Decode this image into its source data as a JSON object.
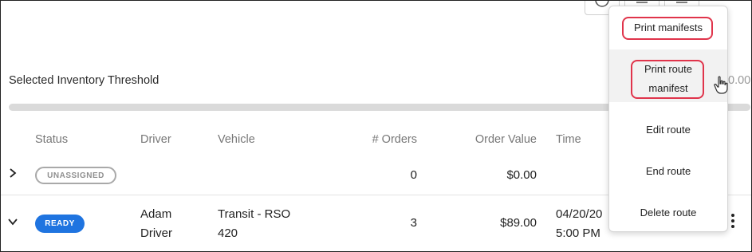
{
  "threshold": {
    "label": "Selected Inventory Threshold",
    "value_partial": "0.00",
    "progress_fraction": 0.0
  },
  "table": {
    "headers": [
      "Status",
      "Driver",
      "Vehicle",
      "# Orders",
      "Order Value",
      "Time"
    ],
    "rows": [
      {
        "status": "UNASSIGNED",
        "driver": "",
        "vehicle": "",
        "orders": "0",
        "order_value": "$0.00",
        "time": ""
      },
      {
        "status": "READY",
        "driver_line1": "Adam",
        "driver_line2": "Driver",
        "vehicle_line1": "Transit - RSO",
        "vehicle_line2": "420",
        "orders": "3",
        "order_value": "$89.00",
        "time_line1": "04/20/20",
        "time_line2": "5:00 PM"
      }
    ]
  },
  "menu": {
    "items": [
      "Print manifests",
      "Print route manifest",
      "Edit route",
      "End route",
      "Delete route"
    ],
    "print_route_line1": "Print route",
    "print_route_line2": "manifest"
  },
  "colors": {
    "ready_badge": "#1f74e0",
    "highlight": "#e0344b",
    "unassigned_border": "#a9a9a9"
  },
  "icons": [
    "chevron-right-icon",
    "chevron-down-icon",
    "kebab-menu-icon",
    "hand-pointer-icon"
  ]
}
